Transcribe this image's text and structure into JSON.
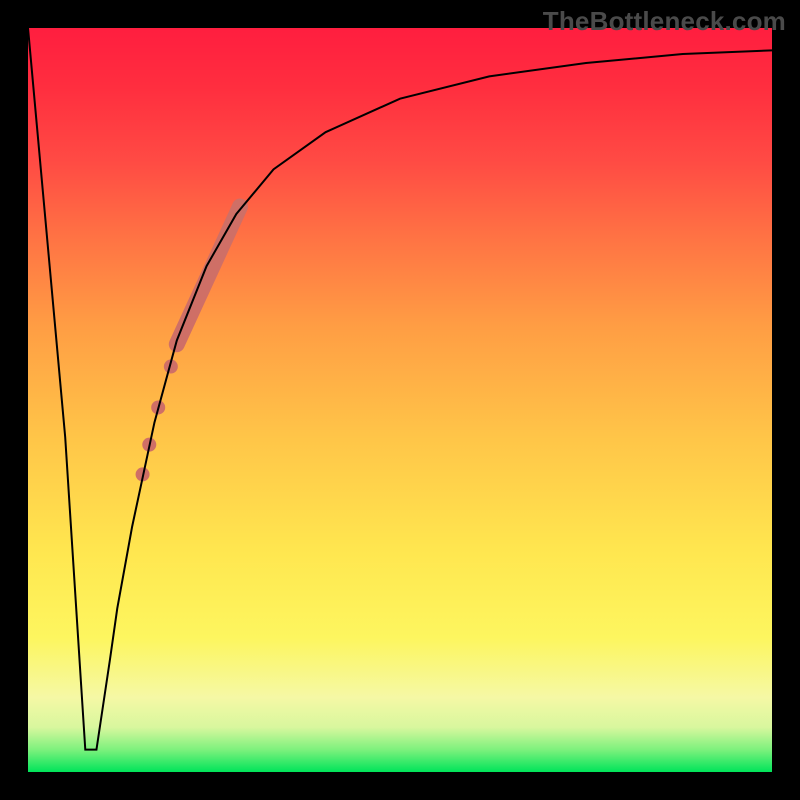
{
  "branding": {
    "watermark": "TheBottleneck.com"
  },
  "chart_data": {
    "type": "line",
    "title": "",
    "xlabel": "",
    "ylabel": "",
    "xlim": [
      0,
      100
    ],
    "ylim": [
      0,
      100
    ],
    "background_gradient": {
      "direction": "vertical-bottom-to-top",
      "stops": [
        {
          "pos": 0,
          "color": "#00e45a"
        },
        {
          "pos": 3,
          "color": "#7df17d"
        },
        {
          "pos": 6,
          "color": "#d8f79e"
        },
        {
          "pos": 10,
          "color": "#f5f8a5"
        },
        {
          "pos": 18,
          "color": "#fdf65f"
        },
        {
          "pos": 30,
          "color": "#ffe64f"
        },
        {
          "pos": 45,
          "color": "#ffc548"
        },
        {
          "pos": 60,
          "color": "#ff9d44"
        },
        {
          "pos": 72,
          "color": "#ff7244"
        },
        {
          "pos": 82,
          "color": "#ff4b44"
        },
        {
          "pos": 92,
          "color": "#ff2e3f"
        },
        {
          "pos": 100,
          "color": "#ff1e3f"
        }
      ]
    },
    "series": [
      {
        "name": "bottleneck-curve",
        "stroke": "#000000",
        "stroke_width": 2,
        "x": [
          0.0,
          2.0,
          5.0,
          7.7,
          9.2,
          11.0,
          12.0,
          14.0,
          17.0,
          20.0,
          24.0,
          28.0,
          33.0,
          40.0,
          50.0,
          62.0,
          75.0,
          88.0,
          100.0
        ],
        "y": [
          100.0,
          78.0,
          45.0,
          3.0,
          3.0,
          15.0,
          22.0,
          33.0,
          47.0,
          58.0,
          68.0,
          75.0,
          81.0,
          86.0,
          90.5,
          93.5,
          95.3,
          96.5,
          97.0
        ]
      }
    ],
    "highlights": {
      "color": "#cf6f66",
      "segments": [
        {
          "x1": 20.0,
          "y1": 57.5,
          "x2": 28.5,
          "y2": 76.0,
          "width": 16
        }
      ],
      "dots": [
        {
          "x": 19.2,
          "y": 54.5,
          "r": 7
        },
        {
          "x": 17.5,
          "y": 49.0,
          "r": 7
        },
        {
          "x": 16.3,
          "y": 44.0,
          "r": 7
        },
        {
          "x": 15.4,
          "y": 40.0,
          "r": 7
        }
      ]
    }
  }
}
